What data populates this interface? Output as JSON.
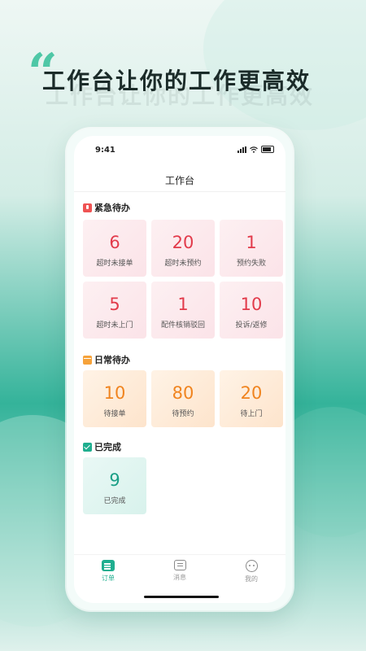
{
  "headline": "工作台让你的工作更高效",
  "quote_mark": "“",
  "phone": {
    "status_time": "9:41",
    "title": "工作台"
  },
  "sections": {
    "urgent": {
      "title": "紧急待办",
      "items": [
        {
          "value": "6",
          "label": "超时未接单"
        },
        {
          "value": "20",
          "label": "超时未预约"
        },
        {
          "value": "1",
          "label": "预约失败"
        },
        {
          "value": "5",
          "label": "超时未上门"
        },
        {
          "value": "1",
          "label": "配件核销驳回"
        },
        {
          "value": "10",
          "label": "投诉/返修"
        }
      ]
    },
    "daily": {
      "title": "日常待办",
      "items": [
        {
          "value": "10",
          "label": "待接单"
        },
        {
          "value": "80",
          "label": "待预约"
        },
        {
          "value": "20",
          "label": "待上门"
        }
      ]
    },
    "done": {
      "title": "已完成",
      "items": [
        {
          "value": "9",
          "label": "已完成"
        }
      ]
    }
  },
  "tabs": [
    {
      "label": "订单",
      "icon": "order-icon",
      "active": true
    },
    {
      "label": "消息",
      "icon": "message-icon",
      "active": false
    },
    {
      "label": "我的",
      "icon": "profile-icon",
      "active": false
    }
  ],
  "colors": {
    "accent": "#1fae8f",
    "urgent": "#e23b4b",
    "daily": "#f0841f"
  }
}
